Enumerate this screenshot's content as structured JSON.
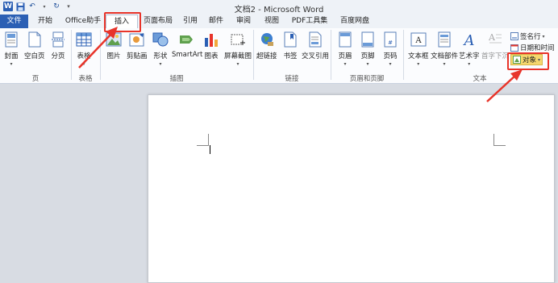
{
  "window": {
    "title": "文档2 - Microsoft Word"
  },
  "quick_access": {
    "icons": [
      "word-logo",
      "save-icon",
      "undo-icon",
      "redo-icon",
      "customize-icon"
    ]
  },
  "tabs": [
    {
      "label": "文件",
      "active": false
    },
    {
      "label": "开始",
      "active": false
    },
    {
      "label": "Office助手",
      "active": false
    },
    {
      "label": "插入",
      "active": true
    },
    {
      "label": "页面布局",
      "active": false
    },
    {
      "label": "引用",
      "active": false
    },
    {
      "label": "邮件",
      "active": false
    },
    {
      "label": "审阅",
      "active": false
    },
    {
      "label": "视图",
      "active": false
    },
    {
      "label": "PDF工具集",
      "active": false
    },
    {
      "label": "百度网盘",
      "active": false
    }
  ],
  "ribbon": {
    "pages": {
      "label": "页",
      "buttons": [
        "封面",
        "空白页",
        "分页"
      ]
    },
    "tables": {
      "label": "表格",
      "buttons": [
        "表格"
      ]
    },
    "illustrations": {
      "label": "插图",
      "buttons": [
        "图片",
        "剪贴画",
        "形状",
        "SmartArt",
        "图表",
        "屏幕截图"
      ]
    },
    "links": {
      "label": "链接",
      "buttons": [
        "超链接",
        "书签",
        "交叉引用"
      ]
    },
    "header_footer": {
      "label": "页眉和页脚",
      "buttons": [
        "页眉",
        "页脚",
        "页码"
      ]
    },
    "text": {
      "label": "文本",
      "buttons": [
        "文本框",
        "文档部件",
        "艺术字",
        "首字下沉"
      ],
      "small_buttons": [
        "签名行",
        "日期和时间",
        "对象"
      ]
    }
  },
  "colors": {
    "accent": "#2b5fb4",
    "highlight": "#e8342a",
    "object_highlight": "#f5d76e"
  }
}
